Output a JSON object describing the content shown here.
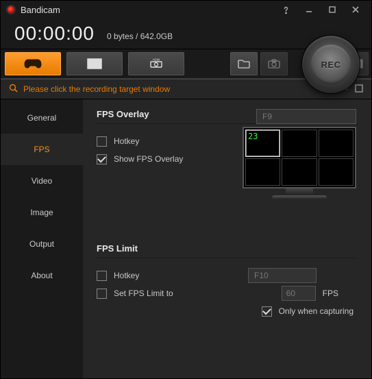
{
  "titlebar": {
    "title": "Bandicam"
  },
  "timer": {
    "value": "00:00:00",
    "size_current": "0 bytes",
    "size_total": "642.0GB"
  },
  "rec": {
    "label": "REC"
  },
  "message": {
    "text": "Please click the recording target window"
  },
  "sidebar": {
    "tabs": [
      "General",
      "FPS",
      "Video",
      "Image",
      "Output",
      "About"
    ],
    "active_index": 1
  },
  "fps": {
    "overlay": {
      "title": "FPS Overlay",
      "hotkey_enabled": false,
      "hotkey_label": "Hotkey",
      "hotkey_value": "F9",
      "show_enabled": true,
      "show_label": "Show FPS Overlay",
      "preview_value": "23"
    },
    "limit": {
      "title": "FPS Limit",
      "hotkey_enabled": false,
      "hotkey_label": "Hotkey",
      "hotkey_value": "F10",
      "set_enabled": false,
      "set_label": "Set FPS Limit to",
      "value": "60",
      "unit": "FPS",
      "only_capturing_enabled": true,
      "only_capturing_label": "Only when capturing"
    }
  }
}
